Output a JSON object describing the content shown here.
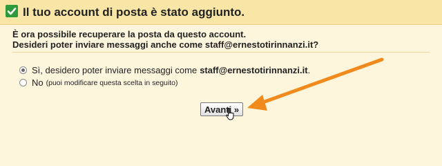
{
  "header": {
    "title": "Il tuo account di posta è stato aggiunto."
  },
  "info": {
    "line1": "È ora possibile recuperare la posta da questo account.",
    "line2": "Desideri poter inviare messaggi anche come staff@ernestotirinnanzi.it?"
  },
  "options": [
    {
      "label": "Sì, desidero poter inviare messaggi come",
      "email": "staff@ernestotirinnanzi.it",
      "suffix": ".",
      "selected": true
    },
    {
      "label": "No",
      "note": "(puoi modificare questa scelta in seguito)",
      "selected": false
    }
  ],
  "button": {
    "label": "Avanti »"
  },
  "colors": {
    "banner": "#f9e6a6",
    "background": "#fdf6dc",
    "check": "#2f9a3b",
    "arrow": "#f08a1c"
  },
  "icons": {
    "header": "check-icon",
    "pointer": "cursor-icon",
    "annotation": "arrow-icon"
  }
}
